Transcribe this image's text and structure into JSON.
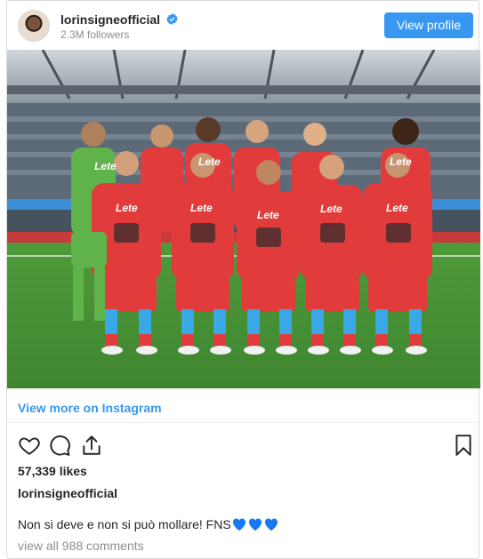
{
  "header": {
    "username": "lorinsigneofficial",
    "followers": "2.3M followers",
    "view_profile_label": "View profile"
  },
  "photo": {
    "alt": "Team photo of SSC Napoli players in red kits on the pitch",
    "shirt_sponsor": "Lete"
  },
  "links": {
    "view_more": "View more on Instagram"
  },
  "actions": {
    "like_icon": "heart-icon",
    "comment_icon": "comment-icon",
    "share_icon": "share-icon",
    "save_icon": "bookmark-icon"
  },
  "post": {
    "likes": "57,339 likes",
    "caption_user": "lorinsigneofficial",
    "caption_text": "Non si deve e non si può mollare! FNS",
    "comments_link": "view all 988 comments"
  },
  "colors": {
    "accent": "#3897f0",
    "heart_emoji": "#1877f2",
    "kit_red": "#e23b3b",
    "kit_blue": "#3aa7e6"
  }
}
